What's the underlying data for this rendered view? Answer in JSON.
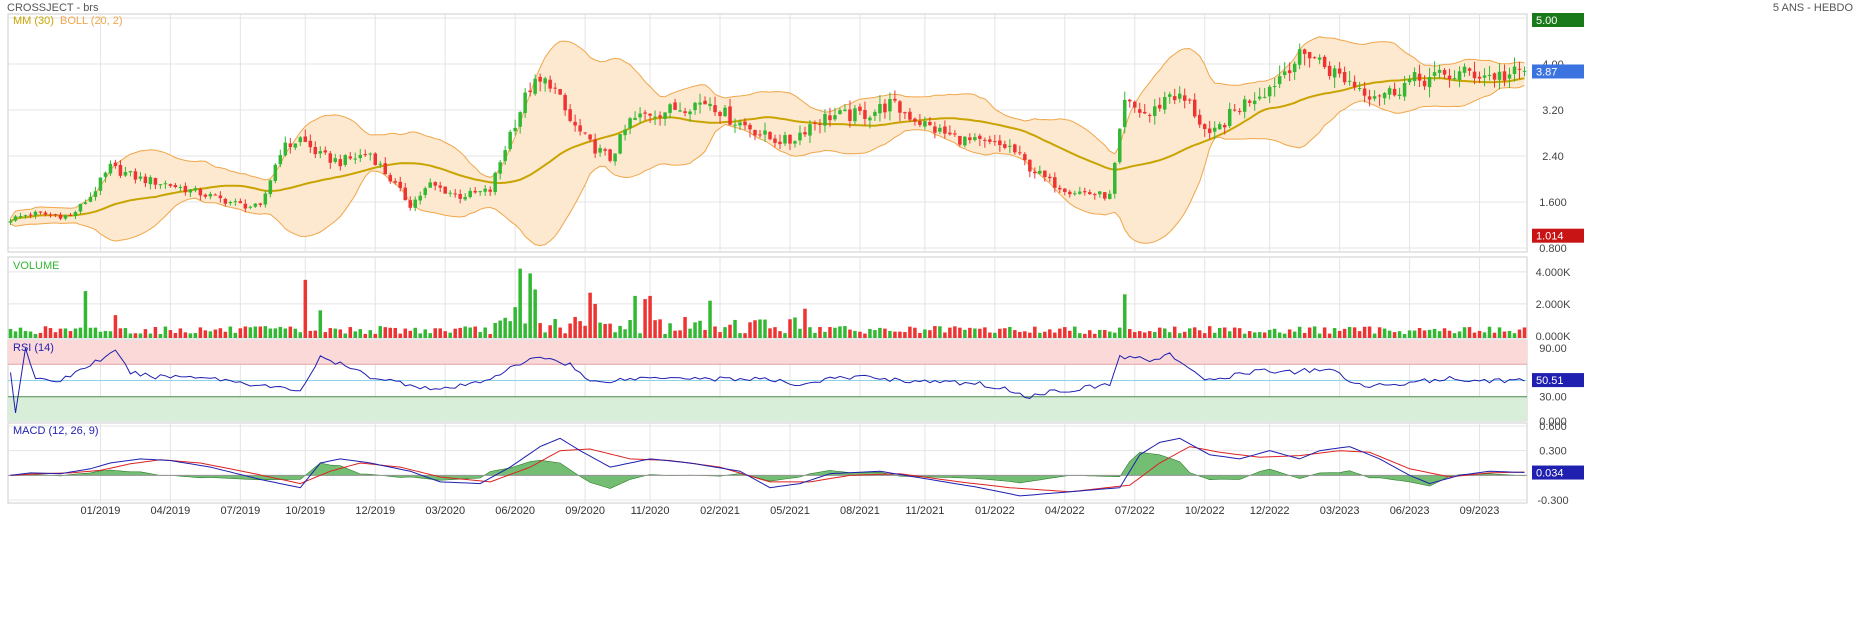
{
  "header": {
    "symbol_title": "CROSSJECT - brs",
    "period": "5 ANS - HEBDO"
  },
  "colors": {
    "up": "#33b833",
    "down": "#ee3333",
    "ma": "#c9a400",
    "boll_fill": "#fde9cf",
    "boll_line": "#f0a64a",
    "rsi_line": "#1f1fb0",
    "macd_line": "#1f1fb0",
    "signal_line": "#dd2222",
    "hist": "#44a844",
    "rsi_over": "#fbd9d9",
    "rsi_under": "#d9eed9",
    "grid": "#e4e4e4",
    "badge_high": "#1a7a1a",
    "badge_last": "#3b74e0",
    "badge_low": "#c81414",
    "badge_rsi": "#1f1fb0",
    "badge_macd": "#1f1fb0"
  },
  "chart_data": [
    {
      "type": "candlestick",
      "panel": "price",
      "legend": [
        "MM (30)",
        "BOLL (20, 2)"
      ],
      "ylim": [
        0.8,
        4.8
      ],
      "yticks": [
        "0.800",
        "1.600",
        "2.40",
        "3.20",
        "4.00",
        "4.80"
      ],
      "badges": {
        "high": "5.00",
        "last": "3.87",
        "low": "1.014"
      },
      "xticks": [
        "01/2019",
        "04/2019",
        "07/2019",
        "10/2019",
        "12/2019",
        "03/2020",
        "06/2020",
        "09/2020",
        "11/2020",
        "02/2021",
        "05/2021",
        "08/2021",
        "11/2021",
        "01/2022",
        "04/2022",
        "07/2022",
        "10/2022",
        "12/2022",
        "03/2023",
        "06/2023",
        "09/2023"
      ],
      "close_path": [
        [
          0,
          1.3
        ],
        [
          4,
          1.4
        ],
        [
          12,
          1.35
        ],
        [
          16,
          1.7
        ],
        [
          20,
          2.2
        ],
        [
          26,
          2.0
        ],
        [
          32,
          1.9
        ],
        [
          40,
          1.7
        ],
        [
          46,
          1.55
        ],
        [
          50,
          1.5
        ],
        [
          54,
          2.5
        ],
        [
          58,
          2.7
        ],
        [
          62,
          2.4
        ],
        [
          66,
          2.3
        ],
        [
          72,
          2.45
        ],
        [
          76,
          2.0
        ],
        [
          80,
          1.55
        ],
        [
          84,
          1.9
        ],
        [
          90,
          1.7
        ],
        [
          96,
          1.8
        ],
        [
          100,
          2.8
        ],
        [
          104,
          3.6
        ],
        [
          108,
          3.7
        ],
        [
          112,
          3.0
        ],
        [
          116,
          2.6
        ],
        [
          120,
          2.35
        ],
        [
          124,
          3.0
        ],
        [
          128,
          3.15
        ],
        [
          132,
          3.2
        ],
        [
          136,
          3.3
        ],
        [
          140,
          3.35
        ],
        [
          144,
          3.05
        ],
        [
          148,
          2.9
        ],
        [
          152,
          2.7
        ],
        [
          156,
          2.65
        ],
        [
          160,
          2.95
        ],
        [
          164,
          3.1
        ],
        [
          168,
          3.1
        ],
        [
          172,
          3.15
        ],
        [
          176,
          3.3
        ],
        [
          180,
          3.1
        ],
        [
          184,
          2.9
        ],
        [
          188,
          2.75
        ],
        [
          192,
          2.65
        ],
        [
          196,
          2.6
        ],
        [
          200,
          2.55
        ],
        [
          204,
          2.2
        ],
        [
          208,
          1.95
        ],
        [
          212,
          1.8
        ],
        [
          216,
          1.75
        ],
        [
          220,
          1.7
        ],
        [
          223,
          3.3
        ],
        [
          228,
          3.1
        ],
        [
          232,
          3.5
        ],
        [
          236,
          3.3
        ],
        [
          240,
          2.7
        ],
        [
          244,
          3.1
        ],
        [
          248,
          3.4
        ],
        [
          252,
          3.6
        ],
        [
          256,
          4.0
        ],
        [
          260,
          4.2
        ],
        [
          264,
          3.9
        ],
        [
          268,
          3.7
        ],
        [
          272,
          3.5
        ],
        [
          276,
          3.5
        ],
        [
          280,
          3.7
        ],
        [
          284,
          3.75
        ],
        [
          288,
          3.8
        ],
        [
          292,
          3.85
        ],
        [
          296,
          3.8
        ],
        [
          300,
          3.8
        ],
        [
          303,
          3.87
        ]
      ],
      "volume": {
        "label": "VOLUME",
        "ylim": [
          0,
          4800
        ],
        "unit": "K",
        "yticks": [
          "0.000K",
          "2.000K",
          "4.000K"
        ],
        "spikes": [
          [
            15,
            2800
          ],
          [
            21,
            1300
          ],
          [
            59,
            3500
          ],
          [
            62,
            1600
          ],
          [
            101,
            1800
          ],
          [
            102,
            4200
          ],
          [
            104,
            3900
          ],
          [
            105,
            2900
          ],
          [
            116,
            2700
          ],
          [
            117,
            2000
          ],
          [
            125,
            2500
          ],
          [
            127,
            2300
          ],
          [
            128,
            2500
          ],
          [
            140,
            2200
          ],
          [
            159,
            1700
          ],
          [
            223,
            2600
          ]
        ]
      }
    },
    {
      "type": "line",
      "panel": "rsi",
      "label": "RSI (14)",
      "ylim": [
        0,
        100
      ],
      "yticks": [
        "0.000",
        "30.00",
        "90.00"
      ],
      "overbought": 70,
      "oversold": 30,
      "mid": 50,
      "badge": "50.51",
      "values_path": [
        [
          0,
          60
        ],
        [
          1,
          10
        ],
        [
          3,
          90
        ],
        [
          5,
          50
        ],
        [
          10,
          50
        ],
        [
          16,
          70
        ],
        [
          21,
          85
        ],
        [
          24,
          60
        ],
        [
          28,
          55
        ],
        [
          38,
          55
        ],
        [
          46,
          48
        ],
        [
          52,
          42
        ],
        [
          58,
          38
        ],
        [
          62,
          78
        ],
        [
          66,
          70
        ],
        [
          72,
          55
        ],
        [
          80,
          45
        ],
        [
          86,
          38
        ],
        [
          94,
          48
        ],
        [
          102,
          70
        ],
        [
          106,
          80
        ],
        [
          112,
          70
        ],
        [
          116,
          48
        ],
        [
          124,
          52
        ],
        [
          132,
          55
        ],
        [
          140,
          52
        ],
        [
          150,
          52
        ],
        [
          158,
          45
        ],
        [
          164,
          52
        ],
        [
          172,
          55
        ],
        [
          178,
          50
        ],
        [
          186,
          48
        ],
        [
          194,
          46
        ],
        [
          200,
          38
        ],
        [
          204,
          30
        ],
        [
          208,
          36
        ],
        [
          214,
          40
        ],
        [
          220,
          45
        ],
        [
          222,
          80
        ],
        [
          228,
          75
        ],
        [
          232,
          83
        ],
        [
          236,
          62
        ],
        [
          240,
          50
        ],
        [
          250,
          63
        ],
        [
          256,
          60
        ],
        [
          264,
          65
        ],
        [
          268,
          48
        ],
        [
          272,
          43
        ],
        [
          280,
          48
        ],
        [
          288,
          52
        ],
        [
          296,
          50
        ],
        [
          303,
          50.51
        ]
      ]
    },
    {
      "type": "line",
      "panel": "macd",
      "label": "MACD (12, 26, 9)",
      "ylim": [
        -0.3,
        0.6
      ],
      "yticks": [
        "-0.300",
        "0.000",
        "0.300",
        "0.600"
      ],
      "badge": "0.034",
      "macd_path": [
        [
          0,
          0.0
        ],
        [
          4,
          0.03
        ],
        [
          10,
          0.02
        ],
        [
          16,
          0.08
        ],
        [
          20,
          0.15
        ],
        [
          26,
          0.2
        ],
        [
          32,
          0.18
        ],
        [
          40,
          0.1
        ],
        [
          50,
          -0.05
        ],
        [
          58,
          -0.15
        ],
        [
          62,
          0.15
        ],
        [
          66,
          0.2
        ],
        [
          72,
          0.15
        ],
        [
          80,
          0.05
        ],
        [
          86,
          -0.08
        ],
        [
          94,
          -0.1
        ],
        [
          100,
          0.1
        ],
        [
          106,
          0.35
        ],
        [
          110,
          0.45
        ],
        [
          114,
          0.3
        ],
        [
          120,
          0.1
        ],
        [
          128,
          0.2
        ],
        [
          136,
          0.15
        ],
        [
          146,
          0.05
        ],
        [
          152,
          -0.15
        ],
        [
          158,
          -0.1
        ],
        [
          164,
          0.02
        ],
        [
          174,
          0.05
        ],
        [
          184,
          -0.05
        ],
        [
          194,
          -0.15
        ],
        [
          202,
          -0.25
        ],
        [
          212,
          -0.2
        ],
        [
          222,
          -0.15
        ],
        [
          226,
          0.25
        ],
        [
          230,
          0.4
        ],
        [
          234,
          0.45
        ],
        [
          240,
          0.25
        ],
        [
          246,
          0.2
        ],
        [
          252,
          0.3
        ],
        [
          258,
          0.2
        ],
        [
          262,
          0.3
        ],
        [
          268,
          0.35
        ],
        [
          274,
          0.2
        ],
        [
          280,
          0.0
        ],
        [
          284,
          -0.1
        ],
        [
          290,
          0.0
        ],
        [
          296,
          0.05
        ],
        [
          303,
          0.034
        ]
      ],
      "signal_path": [
        [
          0,
          0.0
        ],
        [
          6,
          0.02
        ],
        [
          12,
          0.03
        ],
        [
          18,
          0.06
        ],
        [
          24,
          0.14
        ],
        [
          30,
          0.19
        ],
        [
          38,
          0.15
        ],
        [
          48,
          0.03
        ],
        [
          58,
          -0.1
        ],
        [
          64,
          0.05
        ],
        [
          70,
          0.15
        ],
        [
          78,
          0.1
        ],
        [
          86,
          -0.02
        ],
        [
          96,
          -0.08
        ],
        [
          104,
          0.1
        ],
        [
          110,
          0.3
        ],
        [
          116,
          0.32
        ],
        [
          124,
          0.2
        ],
        [
          132,
          0.18
        ],
        [
          142,
          0.1
        ],
        [
          152,
          -0.08
        ],
        [
          160,
          -0.08
        ],
        [
          168,
          0.0
        ],
        [
          178,
          0.02
        ],
        [
          190,
          -0.08
        ],
        [
          200,
          -0.15
        ],
        [
          212,
          -0.2
        ],
        [
          224,
          -0.12
        ],
        [
          230,
          0.15
        ],
        [
          236,
          0.35
        ],
        [
          242,
          0.28
        ],
        [
          250,
          0.22
        ],
        [
          258,
          0.24
        ],
        [
          266,
          0.3
        ],
        [
          272,
          0.28
        ],
        [
          280,
          0.08
        ],
        [
          288,
          -0.02
        ],
        [
          296,
          0.03
        ],
        [
          303,
          0.04
        ]
      ]
    }
  ]
}
